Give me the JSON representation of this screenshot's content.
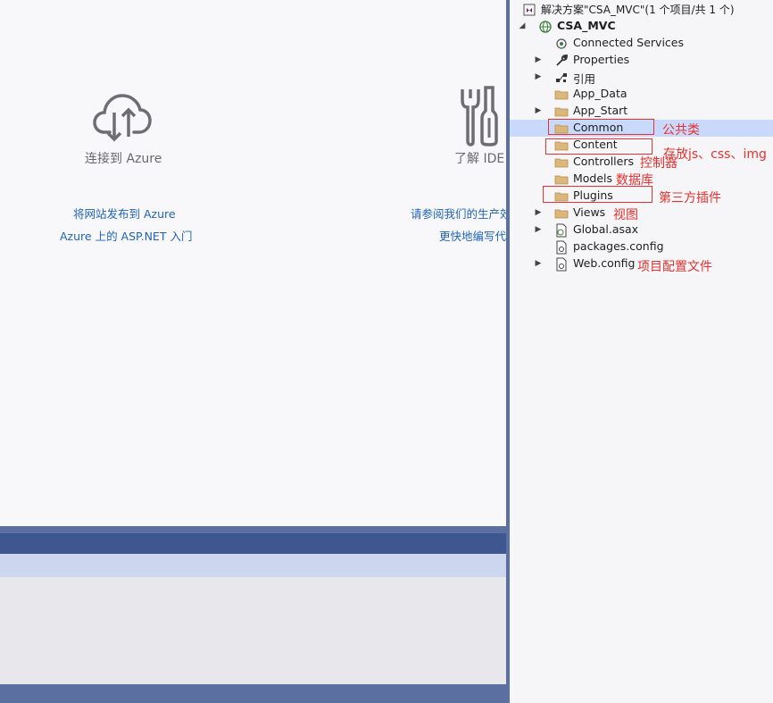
{
  "start_page": {
    "features": [
      {
        "title": "连接到 Azure",
        "icon": "cloud-upload-icon"
      },
      {
        "title": "了解 IDE",
        "icon": "tools-icon"
      }
    ],
    "links_left": [
      "将网站发布到 Azure",
      "Azure 上的 ASP.NET 入门"
    ],
    "links_right": [
      "请参阅我们的生产效",
      "更快地编写代"
    ]
  },
  "solution_explorer": {
    "solution_label": "解决方案\"CSA_MVC\"(1 个项目/共 1 个)",
    "project_label": "CSA_MVC",
    "items": [
      {
        "label": "Connected Services",
        "icon": "connected-services-icon",
        "expandable": false
      },
      {
        "label": "Properties",
        "icon": "wrench-icon",
        "expandable": true
      },
      {
        "label": "引用",
        "icon": "references-icon",
        "expandable": true
      },
      {
        "label": "App_Data",
        "icon": "folder-icon",
        "expandable": false
      },
      {
        "label": "App_Start",
        "icon": "folder-icon",
        "expandable": true
      },
      {
        "label": "Common",
        "icon": "folder-icon",
        "expandable": false,
        "selected": true
      },
      {
        "label": "Content",
        "icon": "folder-icon",
        "expandable": false
      },
      {
        "label": "Controllers",
        "icon": "folder-icon",
        "expandable": false
      },
      {
        "label": "Models",
        "icon": "folder-icon",
        "expandable": false
      },
      {
        "label": "Plugins",
        "icon": "folder-icon",
        "expandable": false
      },
      {
        "label": "Views",
        "icon": "folder-icon",
        "expandable": true
      },
      {
        "label": "Global.asax",
        "icon": "global-asax-icon",
        "expandable": true
      },
      {
        "label": "packages.config",
        "icon": "config-file-icon",
        "expandable": false
      },
      {
        "label": "Web.config",
        "icon": "config-file-icon",
        "expandable": true
      }
    ]
  },
  "annotations": {
    "common": "公共类",
    "content": "存放js、css、img",
    "controllers": "控制器",
    "models": "数据库",
    "plugins": "第三方插件",
    "views": "视图",
    "webconfig": "项目配置文件"
  },
  "colors": {
    "accent_selected": "#c9d9fb",
    "annotation_red": "#e8302e",
    "link_blue": "#1e63b8",
    "status_bar": "#3f5791"
  }
}
